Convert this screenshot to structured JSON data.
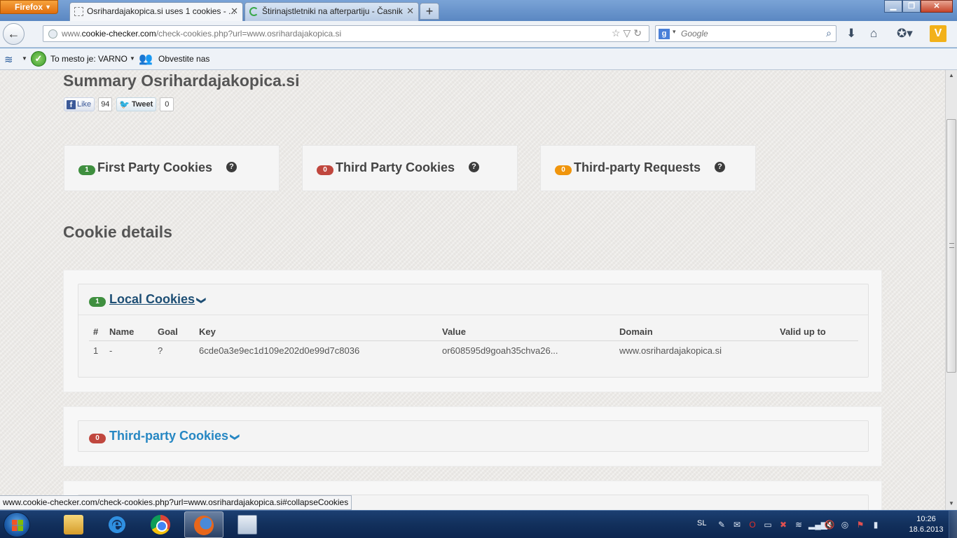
{
  "browser": {
    "app_button": "Firefox",
    "tabs": [
      {
        "title": "Osrihardajakopica.si uses 1 cookies - ...",
        "active": true
      },
      {
        "title": "Štirinajstletniki na afterpartiju - Časnik",
        "active": false
      }
    ],
    "url_prefix": "www.",
    "url_host": "cookie-checker.com",
    "url_path": "/check-cookies.php?url=www.osrihardajakopica.si",
    "search_placeholder": "Google",
    "search_engine_icon": "google-icon",
    "window_buttons": [
      "minimize",
      "maximize",
      "close"
    ]
  },
  "bookmarks": {
    "safety_label": "To mesto je: VARNO",
    "notify_label": "Obvestite nas"
  },
  "page": {
    "title": "Summary Osrihardajakopica.si",
    "social": {
      "like_label": "Like",
      "like_count": "94",
      "tweet_label": "Tweet",
      "tweet_count": "0"
    },
    "summary": [
      {
        "count": "1",
        "label": "First Party Cookies",
        "color": "#3f8f3f"
      },
      {
        "count": "0",
        "label": "Third Party Cookies",
        "color": "#c0473e"
      },
      {
        "count": "0",
        "label": "Third-party Requests",
        "color": "#f0950c"
      }
    ],
    "details_title": "Cookie details",
    "local_panel": {
      "count": "1",
      "title": "Local Cookies",
      "columns": [
        "#",
        "Name",
        "Goal",
        "Key",
        "Value",
        "Domain",
        "Valid up to"
      ],
      "rows": [
        [
          "1",
          "-",
          "?",
          "6cde0a3e9ec1d109e202d0e99d7c8036",
          "or608595d9goah35chva26...",
          "www.osrihardajakopica.si",
          ""
        ]
      ]
    },
    "third_panel": {
      "count": "0",
      "title": "Third-party Cookies"
    }
  },
  "status_bar": {
    "link": "www.cookie-checker.com/check-cookies.php?url=www.osrihardajakopica.si#collapseCookies"
  },
  "taskbar": {
    "apps": [
      "windows-explorer",
      "internet-explorer",
      "google-chrome",
      "firefox",
      "remote-desktop"
    ],
    "language": "SL",
    "time": "10:26",
    "date": "18.6.2013"
  }
}
